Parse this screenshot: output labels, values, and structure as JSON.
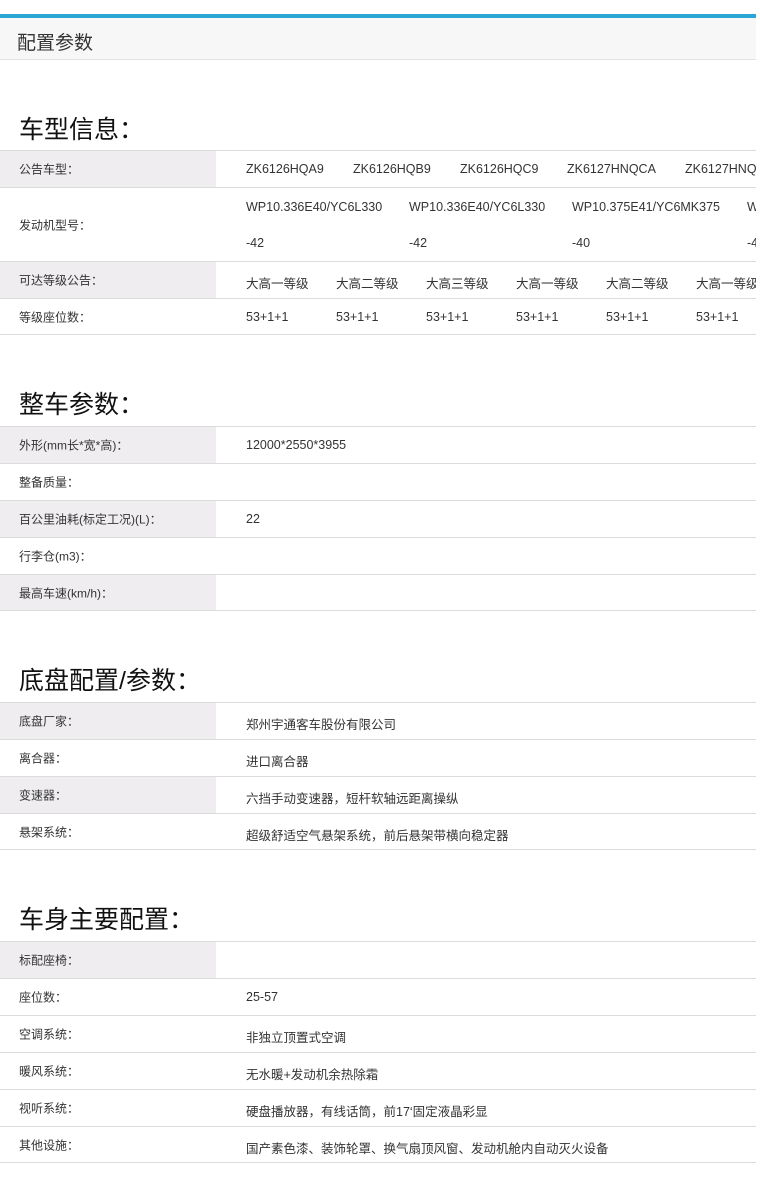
{
  "header": {
    "title": "配置参数"
  },
  "sections": {
    "vehicle_info": {
      "title": "车型信息：",
      "rows": {
        "notice_model": {
          "label": "公告车型：",
          "values": [
            "ZK6126HQA9",
            "ZK6126HQB9",
            "ZK6126HQC9",
            "ZK6127HNQCA",
            "ZK6127HNQ"
          ]
        },
        "engine_model": {
          "label": "发动机型号：",
          "line1": [
            "WP10.336E40/YC6L330",
            "WP10.336E40/YC6L330",
            "WP10.375E41/YC6MK375",
            "W"
          ],
          "line2": [
            "-42",
            "-42",
            "-40",
            "-4"
          ]
        },
        "grade_notice": {
          "label": "可达等级公告：",
          "values": [
            "大高一等级",
            "大高二等级",
            "大高三等级",
            "大高一等级",
            "大高二等级",
            "大高一等级"
          ]
        },
        "grade_seats": {
          "label": "等级座位数：",
          "values": [
            "53+1+1",
            "53+1+1",
            "53+1+1",
            "53+1+1",
            "53+1+1",
            "53+1+1"
          ]
        }
      }
    },
    "vehicle_params": {
      "title": "整车参数：",
      "rows": {
        "dimensions": {
          "label": "外形(mm长*宽*高)：",
          "value": "12000*2550*3955"
        },
        "curb_weight": {
          "label": "整备质量：",
          "value": ""
        },
        "fuel": {
          "label": "百公里油耗(标定工况)(L)：",
          "value": "22"
        },
        "luggage": {
          "label": "行李仓(m3)：",
          "value": ""
        },
        "max_speed": {
          "label": "最高车速(km/h)：",
          "value": ""
        }
      }
    },
    "chassis": {
      "title": "底盘配置/参数：",
      "rows": {
        "maker": {
          "label": "底盘厂家：",
          "value": "郑州宇通客车股份有限公司"
        },
        "clutch": {
          "label": "离合器：",
          "value": "进口离合器"
        },
        "gearbox": {
          "label": "变速器：",
          "value": "六挡手动变速器，短杆软轴远距离操纵"
        },
        "suspension": {
          "label": "悬架系统：",
          "value": "超级舒适空气悬架系统，前后悬架带横向稳定器"
        }
      }
    },
    "body": {
      "title": "车身主要配置：",
      "rows": {
        "std_seats": {
          "label": "标配座椅：",
          "value": ""
        },
        "seat_count": {
          "label": "座位数：",
          "value": "25-57"
        },
        "ac": {
          "label": "空调系统：",
          "value": "非独立顶置式空调"
        },
        "heating": {
          "label": "暖风系统：",
          "value": "无水暖+发动机余热除霜"
        },
        "av": {
          "label": "视听系统：",
          "value": "硬盘播放器，有线话筒，前17‘固定液晶彩显"
        },
        "other": {
          "label": "其他设施：",
          "value": "国产素色漆、装饰轮罩、换气扇顶风窗、发动机舱内自动灭火设备"
        }
      }
    }
  }
}
